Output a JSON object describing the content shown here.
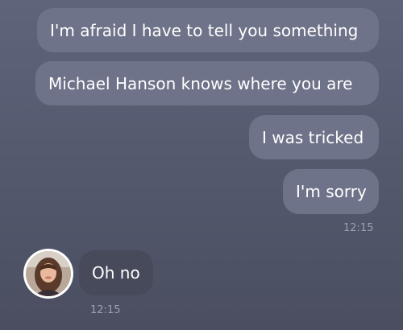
{
  "messages": [
    {
      "text": "I'm afraid I have to tell you something",
      "direction": "sent"
    },
    {
      "text": "Michael Hanson knows where you are",
      "direction": "sent"
    },
    {
      "text": "I was tricked",
      "direction": "sent"
    },
    {
      "text": "I'm sorry",
      "direction": "sent"
    },
    {
      "text": "Oh no",
      "direction": "received"
    }
  ],
  "timestamps": {
    "sent_group": "12:15",
    "received_group": "12:15"
  },
  "avatar": {
    "icon": "contact-avatar-photo"
  },
  "colors": {
    "sent_bubble": "#6f7389",
    "received_bubble": "#474a5b",
    "timestamp": "#9ca0b2"
  }
}
